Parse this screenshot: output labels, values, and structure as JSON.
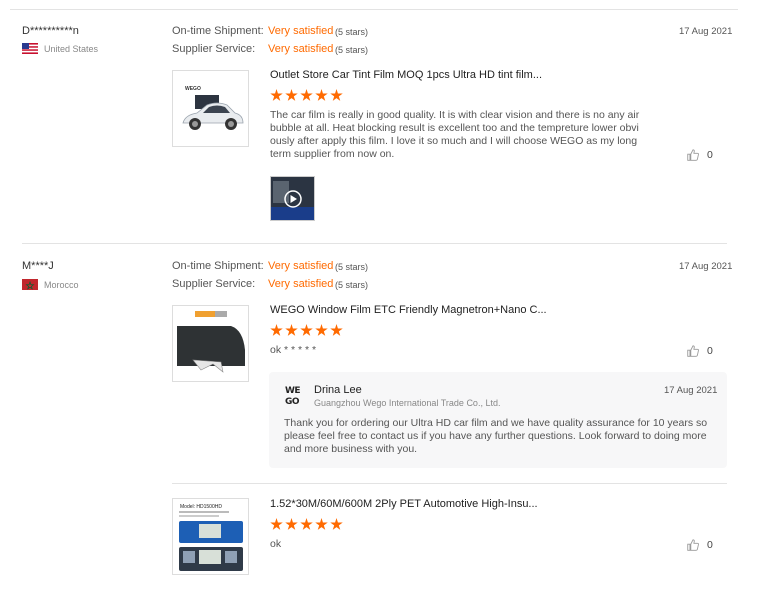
{
  "labels": {
    "ontime": "On-time Shipment:",
    "supplier": "Supplier Service:"
  },
  "reviews": [
    {
      "buyer": "D**********n",
      "country": "United States",
      "ontime_value": "Very satisfied",
      "ontime_stars": "(5 stars)",
      "supplier_value": "Very satisfied",
      "supplier_stars": "(5 stars)",
      "date": "17 Aug 2021",
      "items": [
        {
          "title": "Outlet Store Car Tint Film MOQ 1pcs Ultra HD tint film...",
          "rating": 5,
          "text": "The car film is really in good quality. It is with clear vision and there is no any air bubble at all. Heat blocking result is excellent too and the tempreture lower obviously after apply this film. I love it so much and I will choose WEGO as my long term supplier from now on.",
          "likes": "0",
          "thumb_brand": "WEGO"
        }
      ]
    },
    {
      "buyer": "M****J",
      "country": "Morocco",
      "ontime_value": "Very satisfied",
      "ontime_stars": "(5 stars)",
      "supplier_value": "Very satisfied",
      "supplier_stars": "(5 stars)",
      "date": "17 Aug 2021",
      "items": [
        {
          "title": "WEGO Window Film ETC Friendly Magnetron+Nano C...",
          "rating": 5,
          "text": "ok * * * * *",
          "likes": "0",
          "reply": {
            "logo": "WEGO",
            "name": "Drina Lee",
            "company": "Guangzhou Wego International Trade Co., Ltd.",
            "date": "17 Aug 2021",
            "text": "Thank you for ordering our Ultra HD car film and we have quality assurance for 10 years so please feel free to contact us if you have any further questions. Look forward to doing more and more business with you."
          }
        },
        {
          "title": "1.52*30M/60M/600M 2Ply PET Automotive High-Insu...",
          "rating": 5,
          "text": "ok",
          "likes": "0",
          "thumb_model": "Model:  HD1500HD"
        }
      ]
    }
  ],
  "colors": {
    "accent": "#ff6a00",
    "divider": "#e3e3e3",
    "reply_bg": "#f7f7f8"
  },
  "icons": {
    "like": "thumbs-up-icon",
    "play": "play-icon"
  }
}
